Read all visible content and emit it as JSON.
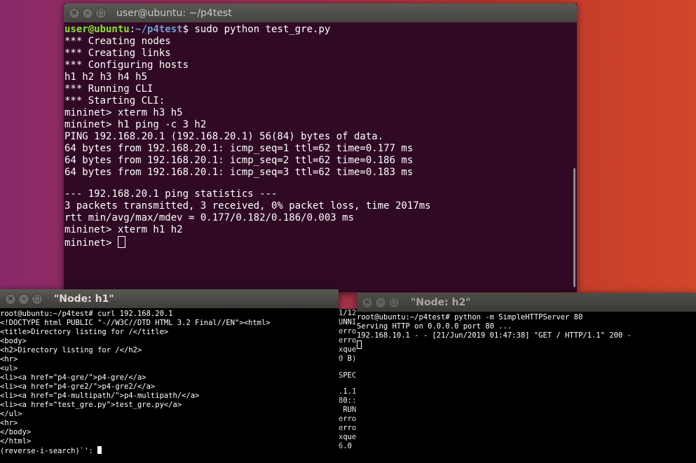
{
  "main_terminal": {
    "title": "user@ubuntu: ~/p4test",
    "prompt_user": "user@ubuntu",
    "prompt_sep": ":",
    "prompt_path": "~/p4test",
    "prompt_cmd": "$ sudo python test_gre.py",
    "lines": [
      "*** Creating nodes",
      "*** Creating links",
      "*** Configuring hosts",
      "h1 h2 h3 h4 h5",
      "*** Running CLI",
      "*** Starting CLI:",
      "mininet> xterm h3 h5",
      "mininet> h1 ping -c 3 h2",
      "PING 192.168.20.1 (192.168.20.1) 56(84) bytes of data.",
      "64 bytes from 192.168.20.1: icmp_seq=1 ttl=62 time=0.177 ms",
      "64 bytes from 192.168.20.1: icmp_seq=2 ttl=62 time=0.186 ms",
      "64 bytes from 192.168.20.1: icmp_seq=3 ttl=62 time=0.183 ms",
      "",
      "--- 192.168.20.1 ping statistics ---",
      "3 packets transmitted, 3 received, 0% packet loss, time 2017ms",
      "rtt min/avg/max/mdev = 0.177/0.182/0.186/0.003 ms",
      "mininet> xterm h1 h2"
    ],
    "last_prompt": "mininet> "
  },
  "h1_xterm": {
    "title": "\"Node: h1\"",
    "lines": [
      "root@ubuntu:~/p4test# curl 192.168.20.1",
      "<!DOCTYPE html PUBLIC \"-//W3C//DTD HTML 3.2 Final//EN\"><html>",
      "<title>Directory listing for /</title>",
      "<body>",
      "<h2>Directory listing for /</h2>",
      "<hr>",
      "<ul>",
      "<li><a href=\"p4-gre/\">p4-gre/</a>",
      "<li><a href=\"p4-gre2/\">p4-gre2/</a>",
      "<li><a href=\"p4-multipath/\">p4-multipath/</a>",
      "<li><a href=\"test_gre.py\">test_gre.py</a>",
      "</ul>",
      "<hr>",
      "</body>",
      "</html>"
    ],
    "search_prompt": "(reverse-i-search)`': "
  },
  "h2_xterm": {
    "title": "\"Node: h2\"",
    "lines": [
      "root@ubuntu:~/p4test# python -m SimpleHTTPServer 80",
      "Serving HTTP on 0.0.0.0 port 80 ...",
      "192.168.10.1 - - [21/Jun/2019 01:47:38] \"GET / HTTP/1.1\" 200 -"
    ]
  },
  "background_fragment": {
    "lines": [
      "1/12",
      "UNNIN",
      "error",
      "error",
      "xque",
      "0 B)",
      "",
      "SPEC",
      "",
      ".1.1",
      "80::",
      " RUN",
      "error",
      "error",
      "xque",
      "6.0"
    ]
  },
  "colors": {
    "terminal_bg": "#300a24",
    "prompt_user": "#8ae234",
    "prompt_path": "#729fcf",
    "xterm_bg": "#000000"
  },
  "icons": {
    "close": "close-icon",
    "minimize": "minimize-icon",
    "maximize": "maximize-icon"
  }
}
